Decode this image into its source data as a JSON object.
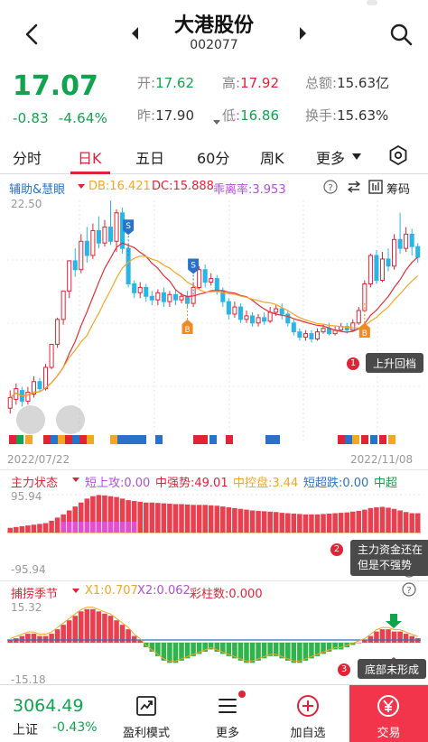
{
  "header": {
    "stock_name": "大港股份",
    "stock_code": "002077"
  },
  "quote": {
    "price": "17.07",
    "change": "-0.83",
    "change_pct": "-4.64%",
    "open_label": "开:",
    "open_value": "17.62",
    "high_label": "高:",
    "high_value": "17.92",
    "amount_label": "总额:",
    "amount_value": "15.63亿",
    "prev_label": "昨:",
    "prev_value": "17.90",
    "low_label": "低:",
    "low_value": "16.86",
    "turnover_label": "换手:",
    "turnover_value": "15.63%"
  },
  "tabs": [
    "分时",
    "日K",
    "五日",
    "60分",
    "周K",
    "更多"
  ],
  "active_tab": "日K",
  "main_chart": {
    "title": "辅助&慧眼",
    "db": "DB:16.421",
    "dc": "DC:15.888",
    "bias": "乖离率:3.953",
    "help": "?",
    "chips_label": "筹码",
    "y_top": "22.50",
    "date_start": "2022/07/22",
    "date_end": "2022/11/08",
    "callout_1": "上升回档",
    "badge_1": "1",
    "signal_s": "S",
    "signal_b": "B"
  },
  "panel2": {
    "title": "主力状态",
    "a": "短上攻:0.00",
    "b": "中强势:49.01",
    "c": "中控盘:3.44",
    "d": "短超跌:0.00",
    "e": "中超",
    "y_top": "95.94",
    "y_bottom": "-95.94",
    "callout_2_line1": "主力资金还在",
    "callout_2_line2": "但是不强势",
    "badge_2": "2",
    "help": "?"
  },
  "panel3": {
    "title": "捕捞季节",
    "x1": "X1:0.707",
    "x2": "X2:0.062",
    "bars": "彩柱数:0.000",
    "y_top": "15.32",
    "y_bottom": "-15.18",
    "callout_3": "底部未形成",
    "badge_3": "3",
    "help": "?"
  },
  "bottom": {
    "index_value": "3064.49",
    "index_name": "上证",
    "index_change": "-0.43%",
    "nav_profit": "盈利模式",
    "nav_more": "更多",
    "nav_add": "加自选",
    "nav_trade": "交易"
  },
  "colors": {
    "up": "#e02437",
    "down": "#11a34d",
    "down_candle": "#29b6e6",
    "ma_red": "#e0303a",
    "ma_orange": "#f5a623",
    "accent": "#e02437"
  },
  "chart_data": [
    {
      "type": "candlestick",
      "title": "辅助&慧眼",
      "x_range": [
        "2022/07/22",
        "2022/11/08"
      ],
      "y_max_label": 22.5,
      "series": [
        {
          "name": "DB",
          "value": 16.421
        },
        {
          "name": "DC",
          "value": 15.888
        },
        {
          "name": "乖离率",
          "value": 3.953
        }
      ],
      "candles": [
        {
          "o": 10.8,
          "c": 11.4,
          "h": 11.8,
          "l": 10.5
        },
        {
          "o": 11.3,
          "c": 11.9,
          "h": 12.2,
          "l": 11.0
        },
        {
          "o": 11.8,
          "c": 11.2,
          "h": 12.0,
          "l": 10.9
        },
        {
          "o": 11.2,
          "c": 11.7,
          "h": 12.0,
          "l": 11.0
        },
        {
          "o": 11.6,
          "c": 12.3,
          "h": 12.6,
          "l": 11.4
        },
        {
          "o": 12.3,
          "c": 11.9,
          "h": 12.5,
          "l": 11.7
        },
        {
          "o": 11.9,
          "c": 13.1,
          "h": 13.3,
          "l": 11.8
        },
        {
          "o": 13.1,
          "c": 14.4,
          "h": 14.4,
          "l": 13.0
        },
        {
          "o": 14.4,
          "c": 15.8,
          "h": 15.9,
          "l": 14.2
        },
        {
          "o": 15.8,
          "c": 17.4,
          "h": 17.4,
          "l": 15.5
        },
        {
          "o": 17.4,
          "c": 19.1,
          "h": 19.1,
          "l": 17.0
        },
        {
          "o": 19.1,
          "c": 18.6,
          "h": 19.8,
          "l": 18.2
        },
        {
          "o": 18.6,
          "c": 20.2,
          "h": 20.6,
          "l": 18.4
        },
        {
          "o": 20.2,
          "c": 19.4,
          "h": 21.0,
          "l": 19.0
        },
        {
          "o": 19.4,
          "c": 20.8,
          "h": 21.2,
          "l": 19.2
        },
        {
          "o": 20.8,
          "c": 20.1,
          "h": 21.6,
          "l": 19.8
        },
        {
          "o": 20.1,
          "c": 21.0,
          "h": 21.4,
          "l": 19.9
        },
        {
          "o": 21.0,
          "c": 20.2,
          "h": 22.5,
          "l": 20.0
        },
        {
          "o": 20.2,
          "c": 21.8,
          "h": 22.0,
          "l": 19.6
        },
        {
          "o": 21.8,
          "c": 19.8,
          "h": 22.1,
          "l": 19.5
        },
        {
          "o": 19.8,
          "c": 17.8,
          "h": 20.0,
          "l": 17.6
        },
        {
          "o": 17.8,
          "c": 17.3,
          "h": 18.0,
          "l": 17.0
        },
        {
          "o": 17.3,
          "c": 17.6,
          "h": 17.9,
          "l": 17.0
        },
        {
          "o": 17.6,
          "c": 17.1,
          "h": 17.8,
          "l": 16.8
        },
        {
          "o": 17.1,
          "c": 16.9,
          "h": 17.4,
          "l": 16.6
        },
        {
          "o": 16.9,
          "c": 17.3,
          "h": 17.5,
          "l": 16.6
        },
        {
          "o": 17.3,
          "c": 16.8,
          "h": 17.6,
          "l": 16.5
        },
        {
          "o": 16.8,
          "c": 17.2,
          "h": 17.4,
          "l": 16.5
        },
        {
          "o": 17.2,
          "c": 16.9,
          "h": 17.5,
          "l": 16.6
        },
        {
          "o": 16.9,
          "c": 17.1,
          "h": 17.3,
          "l": 16.7
        },
        {
          "o": 17.1,
          "c": 16.7,
          "h": 17.4,
          "l": 16.4
        },
        {
          "o": 16.7,
          "c": 17.6,
          "h": 17.8,
          "l": 16.5
        },
        {
          "o": 17.6,
          "c": 18.6,
          "h": 18.8,
          "l": 17.5
        },
        {
          "o": 18.6,
          "c": 17.9,
          "h": 18.9,
          "l": 17.6
        },
        {
          "o": 17.9,
          "c": 18.1,
          "h": 18.4,
          "l": 17.7
        },
        {
          "o": 18.1,
          "c": 17.4,
          "h": 18.3,
          "l": 17.2
        },
        {
          "o": 17.4,
          "c": 16.8,
          "h": 17.6,
          "l": 16.5
        },
        {
          "o": 16.8,
          "c": 16.1,
          "h": 17.0,
          "l": 15.8
        },
        {
          "o": 16.1,
          "c": 16.5,
          "h": 16.8,
          "l": 15.9
        },
        {
          "o": 16.5,
          "c": 15.8,
          "h": 16.7,
          "l": 15.6
        },
        {
          "o": 15.8,
          "c": 16.0,
          "h": 16.3,
          "l": 15.6
        },
        {
          "o": 16.0,
          "c": 15.6,
          "h": 16.2,
          "l": 15.4
        },
        {
          "o": 15.6,
          "c": 15.9,
          "h": 16.1,
          "l": 15.4
        },
        {
          "o": 15.9,
          "c": 15.7,
          "h": 16.2,
          "l": 15.5
        },
        {
          "o": 15.7,
          "c": 16.2,
          "h": 16.5,
          "l": 15.6
        },
        {
          "o": 16.2,
          "c": 16.4,
          "h": 16.6,
          "l": 16.0
        },
        {
          "o": 16.4,
          "c": 16.1,
          "h": 16.7,
          "l": 15.8
        },
        {
          "o": 16.1,
          "c": 15.6,
          "h": 16.3,
          "l": 15.4
        },
        {
          "o": 15.6,
          "c": 15.1,
          "h": 15.8,
          "l": 14.9
        },
        {
          "o": 15.1,
          "c": 14.8,
          "h": 15.3,
          "l": 14.6
        },
        {
          "o": 14.8,
          "c": 15.0,
          "h": 15.2,
          "l": 14.6
        },
        {
          "o": 15.0,
          "c": 14.7,
          "h": 15.2,
          "l": 14.5
        },
        {
          "o": 14.7,
          "c": 15.1,
          "h": 15.3,
          "l": 14.6
        },
        {
          "o": 15.1,
          "c": 15.3,
          "h": 15.5,
          "l": 15.0
        },
        {
          "o": 15.3,
          "c": 15.0,
          "h": 15.6,
          "l": 14.9
        },
        {
          "o": 15.0,
          "c": 15.2,
          "h": 15.4,
          "l": 14.9
        },
        {
          "o": 15.2,
          "c": 15.4,
          "h": 15.6,
          "l": 15.1
        },
        {
          "o": 15.4,
          "c": 15.2,
          "h": 15.6,
          "l": 15.0
        },
        {
          "o": 15.2,
          "c": 15.6,
          "h": 15.8,
          "l": 15.1
        },
        {
          "o": 15.6,
          "c": 16.3,
          "h": 16.5,
          "l": 15.5
        },
        {
          "o": 16.3,
          "c": 17.8,
          "h": 18.0,
          "l": 16.2
        },
        {
          "o": 17.8,
          "c": 19.4,
          "h": 19.5,
          "l": 17.6
        },
        {
          "o": 19.4,
          "c": 18.0,
          "h": 19.7,
          "l": 17.8
        },
        {
          "o": 18.0,
          "c": 19.2,
          "h": 19.6,
          "l": 17.9
        },
        {
          "o": 19.2,
          "c": 18.8,
          "h": 19.8,
          "l": 18.5
        },
        {
          "o": 18.8,
          "c": 20.3,
          "h": 20.6,
          "l": 18.6
        },
        {
          "o": 20.3,
          "c": 19.8,
          "h": 21.8,
          "l": 19.5
        },
        {
          "o": 19.8,
          "c": 20.6,
          "h": 21.0,
          "l": 19.6
        },
        {
          "o": 20.6,
          "c": 19.9,
          "h": 20.9,
          "l": 19.4
        },
        {
          "o": 19.9,
          "c": 19.3,
          "h": 20.1,
          "l": 19.0
        }
      ]
    },
    {
      "type": "bar",
      "title": "主力状态",
      "series": [
        {
          "name": "短上攻",
          "value": 0.0
        },
        {
          "name": "中强势",
          "value": 49.01
        },
        {
          "name": "中控盘",
          "value": 3.44
        },
        {
          "name": "短超跌",
          "value": 0.0
        }
      ],
      "ylim": [
        -95.94,
        95.94
      ],
      "values": [
        12,
        14,
        16,
        18,
        20,
        22,
        24,
        30,
        38,
        46,
        56,
        66,
        76,
        86,
        92,
        95,
        94,
        92,
        90,
        86,
        82,
        80,
        78,
        76,
        76,
        75,
        74,
        73,
        72,
        72,
        71,
        70,
        70,
        70,
        69,
        68,
        66,
        64,
        62,
        60,
        58,
        56,
        55,
        54,
        53,
        52,
        50,
        49,
        48,
        47,
        46,
        46,
        46,
        47,
        48,
        49,
        50,
        51,
        53,
        55,
        58,
        62,
        64,
        65,
        63,
        60,
        56,
        52,
        49,
        49
      ]
    },
    {
      "type": "bar",
      "title": "捕捞季节",
      "series": [
        {
          "name": "X1",
          "value": 0.707
        },
        {
          "name": "X2",
          "value": 0.062
        },
        {
          "name": "彩柱数",
          "value": 0.0
        }
      ],
      "ylim": [
        -15.18,
        15.32
      ],
      "values": [
        1,
        2,
        3,
        4,
        4,
        3,
        3,
        4,
        6,
        8,
        10,
        12,
        14,
        15,
        15,
        14,
        13,
        12,
        10,
        8,
        6,
        3,
        1,
        -2,
        -4,
        -6,
        -8,
        -9,
        -9,
        -8,
        -7,
        -6,
        -5,
        -4,
        -3,
        -4,
        -5,
        -6,
        -7,
        -8,
        -9,
        -9,
        -8,
        -7,
        -6,
        -6,
        -7,
        -8,
        -9,
        -9,
        -8,
        -7,
        -6,
        -5,
        -4,
        -3,
        -3,
        -2,
        -1,
        0,
        1,
        3,
        5,
        6,
        6,
        5,
        5,
        4,
        3,
        2
      ]
    }
  ]
}
